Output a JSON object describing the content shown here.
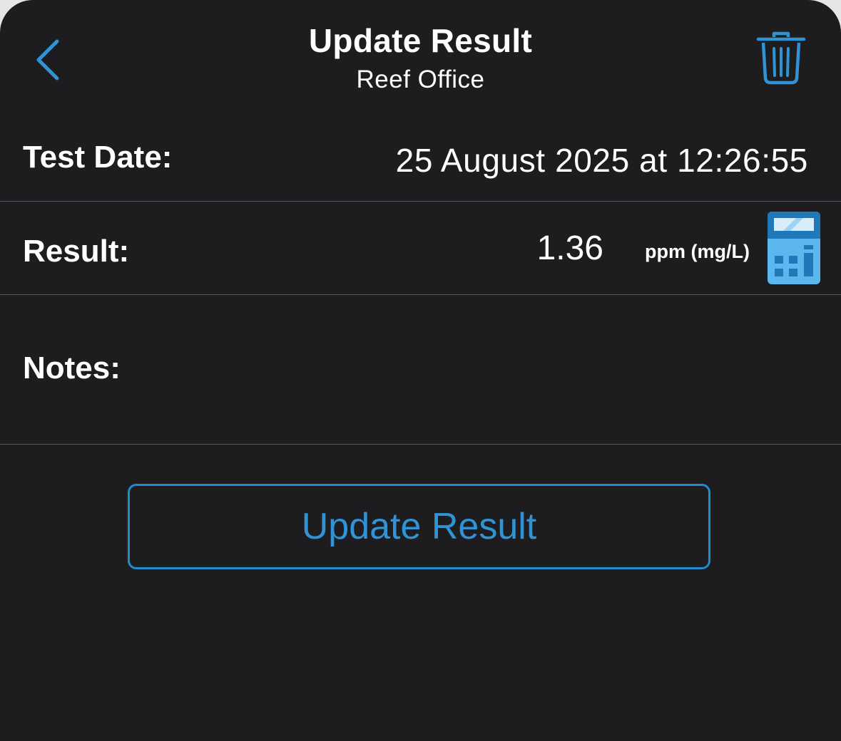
{
  "header": {
    "title": "Update Result",
    "subtitle": "Reef Office"
  },
  "form": {
    "test_date_label": "Test Date:",
    "test_date_value": "25 August 2025 at 12:26:55",
    "result_label": "Result:",
    "result_value": "1.36",
    "result_unit": "ppm (mg/L)",
    "notes_label": "Notes:",
    "notes_value": ""
  },
  "actions": {
    "update_label": "Update Result"
  },
  "icons": {
    "back": "chevron-left-icon",
    "delete": "trash-icon",
    "calculator": "calculator-icon"
  },
  "colors": {
    "background": "#1d1d1f",
    "accent": "#2f93d6",
    "separator": "#58585c",
    "calculator_body": "#5bb7ee",
    "calculator_top": "#1f78b8"
  }
}
